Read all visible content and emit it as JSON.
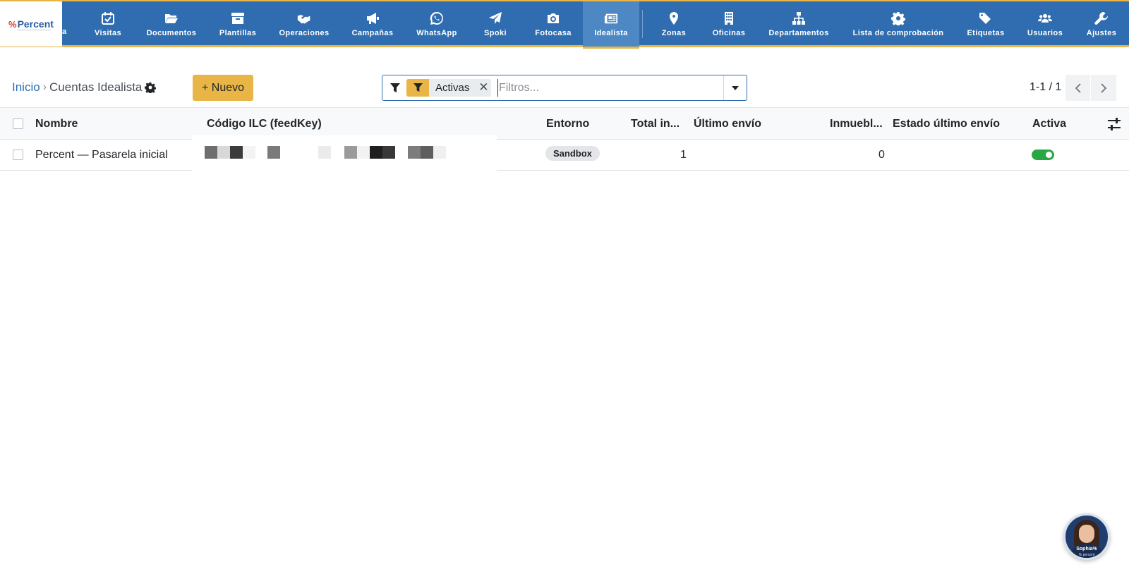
{
  "app": {
    "logo_text": "Percent",
    "logo_mark": "%",
    "cut_nav_label": "a"
  },
  "nav": {
    "items": [
      {
        "label": "Visitas",
        "icon": "calendar-check-icon"
      },
      {
        "label": "Documentos",
        "icon": "folder-open-icon"
      },
      {
        "label": "Plantillas",
        "icon": "archive-icon"
      },
      {
        "label": "Operaciones",
        "icon": "handshake-icon"
      },
      {
        "label": "Campañas",
        "icon": "bullhorn-icon"
      },
      {
        "label": "WhatsApp",
        "icon": "whatsapp-icon"
      },
      {
        "label": "Spoki",
        "icon": "paper-plane-icon"
      },
      {
        "label": "Fotocasa",
        "icon": "camera-icon"
      },
      {
        "label": "Idealista",
        "icon": "newspaper-icon"
      },
      {
        "label": "Zonas",
        "icon": "map-marker-icon"
      },
      {
        "label": "Oficinas",
        "icon": "building-icon"
      },
      {
        "label": "Departamentos",
        "icon": "sitemap-icon"
      },
      {
        "label": "Lista de comprobación",
        "icon": "gear-icon"
      },
      {
        "label": "Etiquetas",
        "icon": "tags-icon"
      },
      {
        "label": "Usuarios",
        "icon": "users-icon"
      },
      {
        "label": "Ajustes",
        "icon": "wrench-icon"
      }
    ],
    "active": "Idealista"
  },
  "breadcrumb": {
    "root": "Inicio",
    "separator": "›",
    "current": "Cuentas Idealista"
  },
  "actions": {
    "new_label": "+ Nuevo"
  },
  "search": {
    "facet_label": "Activas",
    "facet_close": "✕",
    "placeholder": "Filtros..."
  },
  "pager": {
    "value": "1-1 / 1"
  },
  "table": {
    "columns": [
      "Nombre",
      "Código ILC (feedKey)",
      "Entorno",
      "Total in...",
      "Último envío",
      "Inmuebl...",
      "Estado último envío",
      "Activa"
    ],
    "rows": [
      {
        "nombre": "Percent — Pasarela inicial",
        "codigo": "",
        "entorno": "Sandbox",
        "total": "1",
        "ultimo_envio": "",
        "inmuebles": "0",
        "estado": "",
        "activa": true
      }
    ]
  },
  "assistant": {
    "name": "Sophia%",
    "sub": "% percent"
  },
  "colors": {
    "nav_bg": "#2f6db0",
    "nav_active": "#4d88c4",
    "accent": "#e8b546",
    "link": "#2f6db0",
    "toggle_on": "#28a745"
  }
}
